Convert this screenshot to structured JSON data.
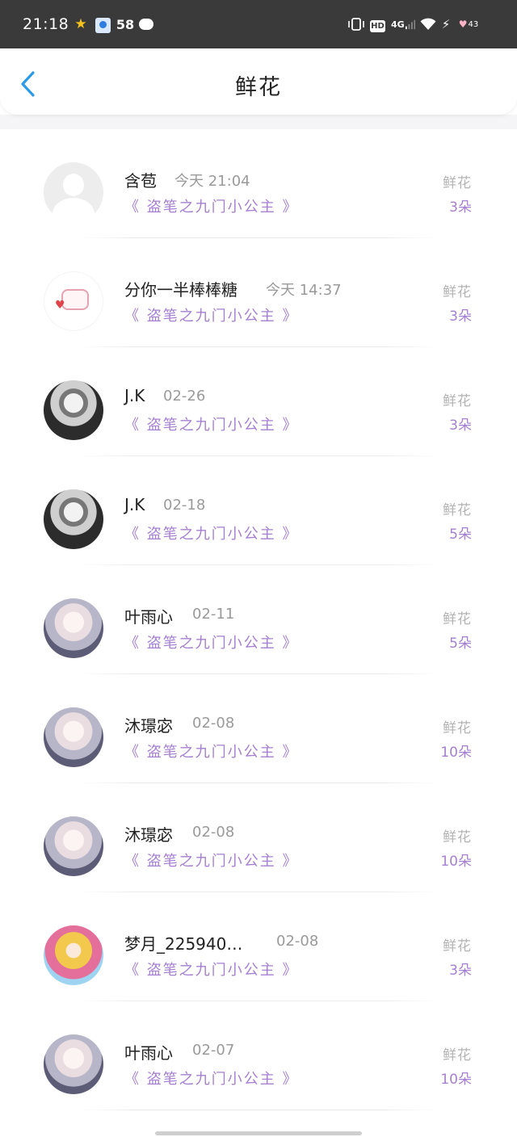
{
  "status_bar": {
    "time": "21:18",
    "notification_count": "58",
    "network": "4G",
    "hd": "HD",
    "battery": "43",
    "icons": [
      "star-icon",
      "app-icon",
      "chat-icon",
      "vibrate-icon",
      "hd-icon",
      "signal-icon",
      "wifi-icon",
      "charging-icon",
      "battery-heart-icon"
    ]
  },
  "header": {
    "title": "鲜花",
    "back_icon": "chevron-left-icon",
    "accent_color": "#2d9ae8"
  },
  "colors": {
    "book_title": "#a57fd1",
    "count": "#a57fd1",
    "label": "#b3b3b3"
  },
  "gifts": [
    {
      "name": "含苞",
      "time": "今天 21:04",
      "book": "《 盗笔之九门小公主 》",
      "label": "鲜花",
      "count": "3朵",
      "avatar": "default-avatar"
    },
    {
      "name": "分你一半棒棒糖",
      "time": "今天 14:37",
      "book": "《 盗笔之九门小公主 》",
      "label": "鲜花",
      "count": "3朵",
      "avatar": "cat-avatar"
    },
    {
      "name": "J.K",
      "time": "02-26",
      "book": "《 盗笔之九门小公主 》",
      "label": "鲜花",
      "count": "3朵",
      "avatar": "bw-photo-avatar"
    },
    {
      "name": "J.K",
      "time": "02-18",
      "book": "《 盗笔之九门小公主 》",
      "label": "鲜花",
      "count": "5朵",
      "avatar": "bw-photo-avatar"
    },
    {
      "name": "叶雨心",
      "time": "02-11",
      "book": "《 盗笔之九门小公主 》",
      "label": "鲜花",
      "count": "5朵",
      "avatar": "anime-avatar"
    },
    {
      "name": "沐璟宓",
      "time": "02-08",
      "book": "《 盗笔之九门小公主 》",
      "label": "鲜花",
      "count": "10朵",
      "avatar": "anime-avatar"
    },
    {
      "name": "沐璟宓",
      "time": "02-08",
      "book": "《 盗笔之九门小公主 》",
      "label": "鲜花",
      "count": "10朵",
      "avatar": "anime-avatar"
    },
    {
      "name": "梦月_225940…",
      "time": "02-08",
      "book": "《 盗笔之九门小公主 》",
      "label": "鲜花",
      "count": "3朵",
      "avatar": "anime-girl-avatar"
    },
    {
      "name": "叶雨心",
      "time": "02-07",
      "book": "《 盗笔之九门小公主 》",
      "label": "鲜花",
      "count": "10朵",
      "avatar": "anime-avatar"
    }
  ]
}
